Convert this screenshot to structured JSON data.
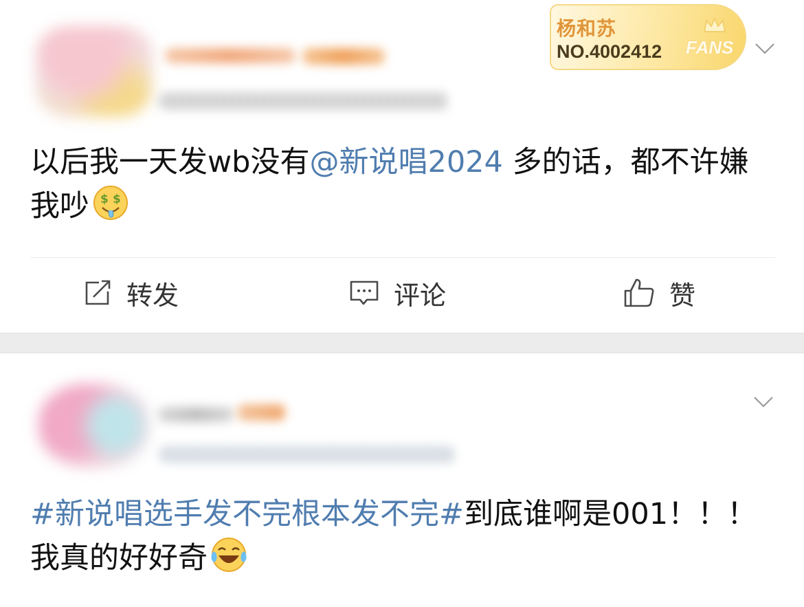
{
  "post1": {
    "fans_badge": {
      "name": "杨和苏",
      "number": "NO.4002412",
      "label": "FANS"
    },
    "text_before": "以后我一天发wb没有",
    "mention": "@新说唱2024",
    "text_after": " 多的话，都不许嫌我吵",
    "emoji": "money-mouth-emoji",
    "actions": {
      "repost": "转发",
      "comment": "评论",
      "like": "赞"
    }
  },
  "post2": {
    "hashtag": "#新说唱选手发不完根本发不完#",
    "text": "到底谁啊是001！！！ 我真的好好奇",
    "emoji": "laughing-crying-emoji"
  },
  "colors": {
    "link": "#507daf",
    "badge_name": "#e0953a",
    "separator": "#ececec"
  }
}
